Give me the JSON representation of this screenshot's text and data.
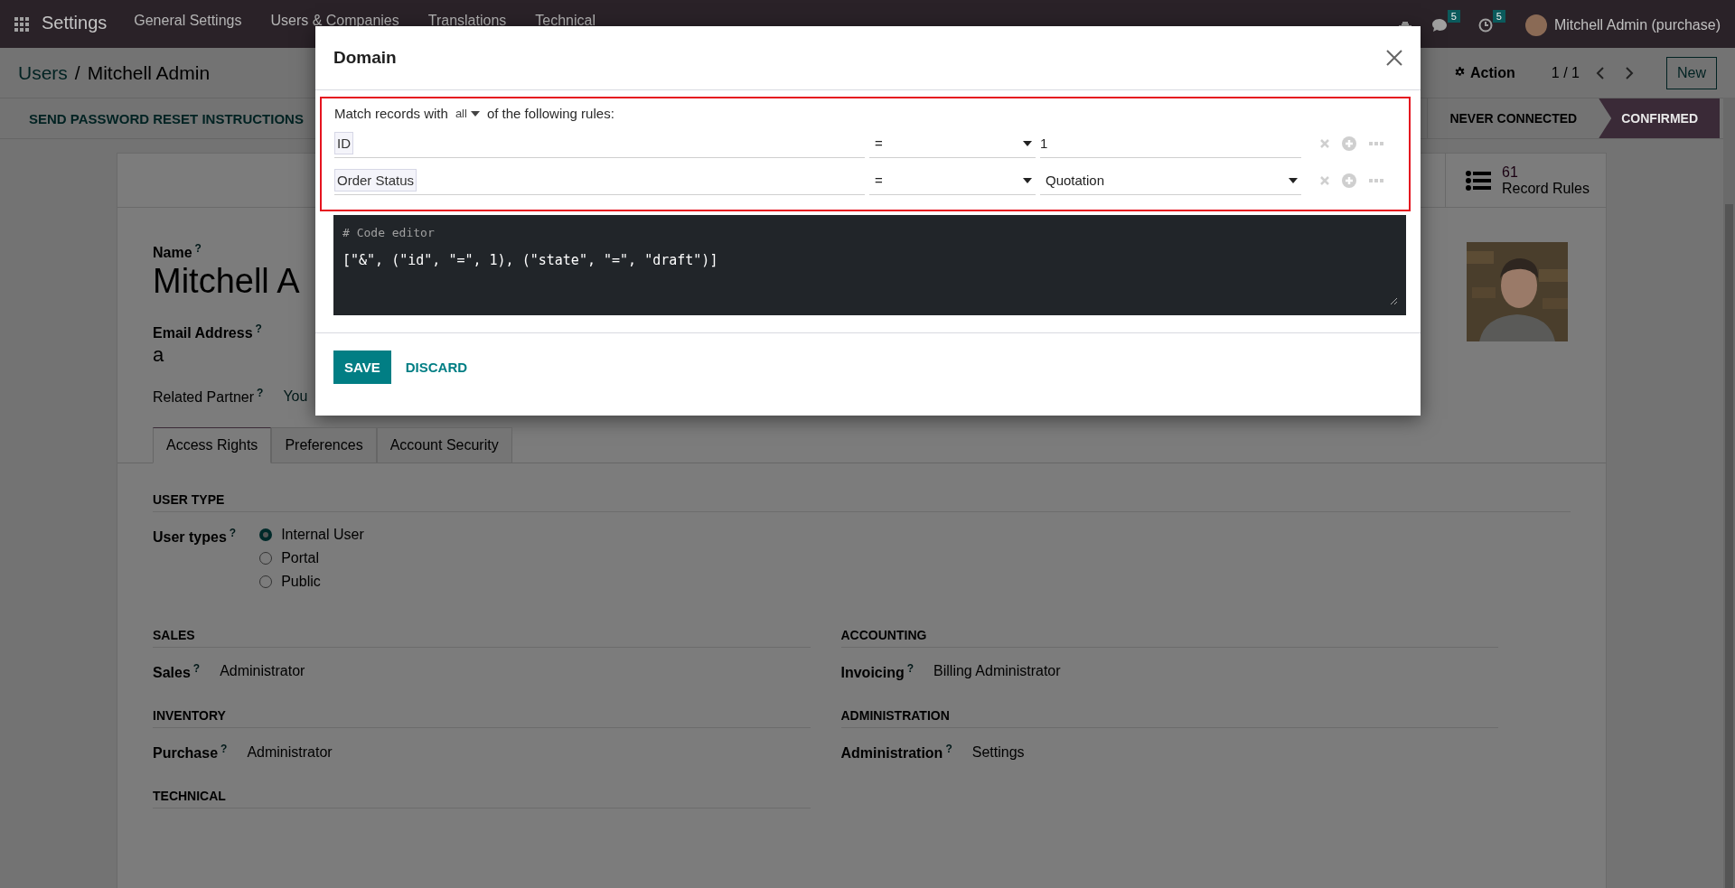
{
  "navbar": {
    "app_title": "Settings",
    "menu": [
      "General Settings",
      "Users & Companies",
      "Translations",
      "Technical"
    ],
    "chat_badge": "5",
    "activity_badge": "5",
    "user": "Mitchell Admin (purchase)"
  },
  "control_panel": {
    "breadcrumb": [
      "Users",
      "Mitchell Admin"
    ],
    "separator": "/",
    "action": "Action",
    "pager": "1 / 1",
    "new_button": "New"
  },
  "status_bar": {
    "button": "SEND PASSWORD RESET INSTRUCTIONS",
    "stages": [
      {
        "label": "NEVER CONNECTED",
        "selected": false
      },
      {
        "label": "CONFIRMED",
        "selected": true
      }
    ]
  },
  "sheet": {
    "stat": {
      "value": "61",
      "label": "Record Rules"
    },
    "name_label": "Name",
    "name_help": "?",
    "name": "Mitchell A",
    "email_label": "Email Address",
    "email_help": "?",
    "email": "a",
    "partner_label": "Related Partner",
    "partner_help": "?",
    "partner": "You",
    "tabs": [
      {
        "label": "Access Rights",
        "selected": true
      },
      {
        "label": "Preferences",
        "selected": false
      },
      {
        "label": "Account Security",
        "selected": false
      }
    ],
    "user_type": {
      "title": "USER TYPE",
      "label": "User types",
      "help": "?",
      "options": [
        {
          "label": "Internal User",
          "selected": true
        },
        {
          "label": "Portal",
          "selected": false
        },
        {
          "label": "Public",
          "selected": false
        }
      ]
    },
    "groups": [
      [
        {
          "title": "SALES",
          "label": "Sales",
          "help": "?",
          "value": "Administrator"
        },
        {
          "title": "INVENTORY",
          "label": "Purchase",
          "help": "?",
          "value": "Administrator"
        },
        {
          "title": "TECHNICAL"
        }
      ],
      [
        {
          "title": "ACCOUNTING",
          "label": "Invoicing",
          "help": "?",
          "value": "Billing Administrator"
        },
        {
          "title": "ADMINISTRATION",
          "label": "Administration",
          "help": "?",
          "value": "Settings"
        }
      ]
    ]
  },
  "dialog": {
    "title": "Domain",
    "highlighted": true,
    "match_prefix": "Match records with",
    "match_mode": "all",
    "match_suffix": "of the following rules:",
    "rules": [
      {
        "field": "ID",
        "operator": "=",
        "value": "1",
        "kind": "input"
      },
      {
        "field": "Order Status",
        "operator": "=",
        "value": "Quotation",
        "kind": "select"
      }
    ],
    "code_comment": "# Code editor",
    "code": "[\"&\", (\"id\", \"=\", 1), (\"state\", \"=\", \"draft\")]",
    "buttons": [
      {
        "label": "SAVE",
        "kind": "primary"
      },
      {
        "label": "DISCARD",
        "kind": "link"
      }
    ]
  }
}
